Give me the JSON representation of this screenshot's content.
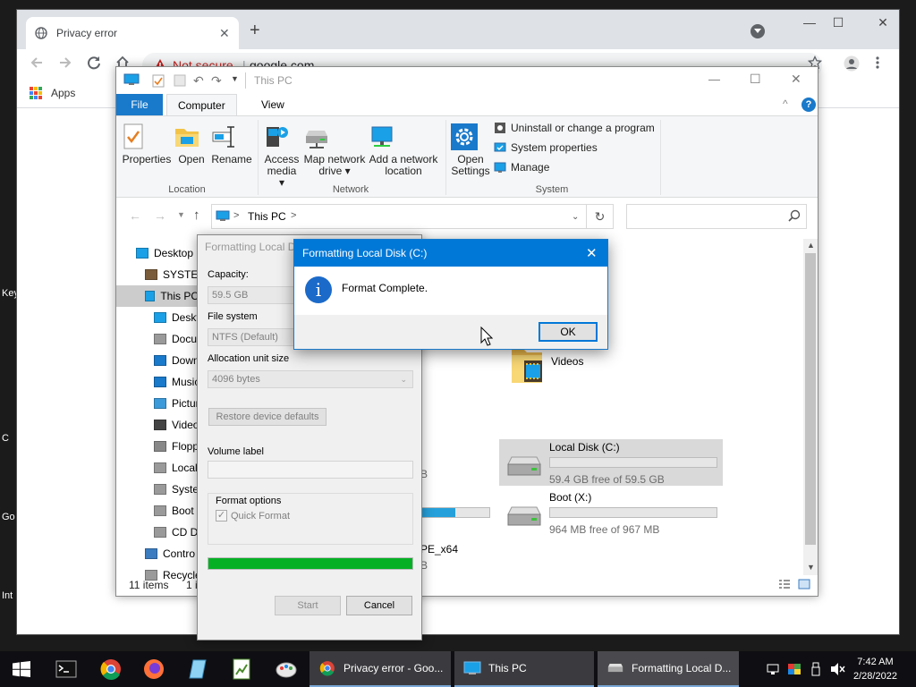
{
  "desktop": {
    "edge_labels": [
      "Key",
      "C",
      "Go",
      "Int"
    ]
  },
  "chrome": {
    "tab_title": "Privacy error",
    "tab_close": "✕",
    "new_tab": "+",
    "omnibox_status": "Not secure",
    "omnibox_separator": "|",
    "omnibox_url": "google.com",
    "bookmark_apps": "Apps",
    "minimize": "—",
    "maximize": "☐",
    "close": "✕",
    "icons": [
      "globe-icon",
      "back-icon",
      "forward-icon",
      "reload-icon",
      "home-icon",
      "warning-icon",
      "star-icon",
      "account-icon",
      "menu-icon",
      "apps-icon"
    ]
  },
  "explorer": {
    "title": "This PC",
    "ribbon_tabs": [
      "File",
      "Computer",
      "View"
    ],
    "help": "?",
    "location_group": {
      "label": "Location",
      "buttons": [
        "Properties",
        "Open",
        "Rename"
      ]
    },
    "network_group": {
      "label": "Network",
      "buttons": [
        {
          "l1": "Access",
          "l2": "media ▾"
        },
        {
          "l1": "Map network",
          "l2": "drive ▾"
        },
        {
          "l1": "Add a network",
          "l2": "location"
        }
      ]
    },
    "system_group": {
      "label": "System",
      "open_settings": {
        "l1": "Open",
        "l2": "Settings"
      },
      "items": [
        "Uninstall or change a program",
        "System properties",
        "Manage"
      ]
    },
    "address": {
      "path": "This PC",
      "chevron": ">",
      "refresh": "↻"
    },
    "nav_pane": [
      {
        "label": "Desktop",
        "indent": 0,
        "selected": false
      },
      {
        "label": "SYSTEM",
        "indent": 1,
        "selected": false
      },
      {
        "label": "This PC",
        "indent": 1,
        "selected": true
      },
      {
        "label": "Deskt",
        "indent": 2,
        "selected": false
      },
      {
        "label": "Docu",
        "indent": 2,
        "selected": false
      },
      {
        "label": "Down",
        "indent": 2,
        "selected": false
      },
      {
        "label": "Music",
        "indent": 2,
        "selected": false
      },
      {
        "label": "Pictur",
        "indent": 2,
        "selected": false
      },
      {
        "label": "Video",
        "indent": 2,
        "selected": false
      },
      {
        "label": "Flopp",
        "indent": 2,
        "selected": false
      },
      {
        "label": "Local",
        "indent": 2,
        "selected": false
      },
      {
        "label": "Syster",
        "indent": 2,
        "selected": false
      },
      {
        "label": "Boot",
        "indent": 2,
        "selected": false
      },
      {
        "label": "CD Dr",
        "indent": 2,
        "selected": false
      },
      {
        "label": "Contro",
        "indent": 1,
        "selected": false
      },
      {
        "label": "Recycle",
        "indent": 1,
        "selected": false
      }
    ],
    "folders": {
      "videos": "Videos"
    },
    "drives": [
      {
        "name": "Local Disk (C:)",
        "free": "59.4 GB free of 59.5 GB",
        "used_fraction": 0.0
      },
      {
        "name": "Boot (X:)",
        "free": "964 MB free of 967 MB",
        "used_fraction": 0.0
      }
    ],
    "partial_drive": {
      "label_fragment": "PE_x64",
      "sub_fragment": "B",
      "letter_fragment": "B",
      "used_fraction": 0.5
    },
    "status_count": "11 items",
    "status_fragment": "1 i",
    "window_controls": {
      "minimize": "—",
      "maximize": "☐",
      "close": "✕"
    },
    "collapse": "^"
  },
  "format_dialog": {
    "title": "Formatting Local D",
    "capacity_label": "Capacity:",
    "capacity_value": "59.5 GB",
    "filesystem_label": "File system",
    "filesystem_value": "NTFS (Default)",
    "alloc_label": "Allocation unit size",
    "alloc_value": "4096 bytes",
    "restore_button": "Restore device defaults",
    "volume_label": "Volume label",
    "volume_value": "",
    "format_options_label": "Format options",
    "quick_format_label": "Quick Format",
    "quick_format_checked": true,
    "progress": 1.0,
    "start_button": "Start",
    "cancel_button": "Cancel"
  },
  "message_box": {
    "title": "Formatting Local Disk (C:)",
    "close": "✕",
    "icon_glyph": "i",
    "message": "Format Complete.",
    "ok_button": "OK"
  },
  "taskbar": {
    "buttons": [
      {
        "label": "Privacy error - Goo..."
      },
      {
        "label": "This PC"
      },
      {
        "label": "Formatting Local D..."
      }
    ],
    "time": "7:42 AM",
    "date": "2/28/2022"
  },
  "colors": {
    "accent_blue": "#0078d7",
    "progress_green": "#06b025",
    "drive_bar_blue": "#26a0da",
    "not_secure_red": "#c5221f"
  }
}
